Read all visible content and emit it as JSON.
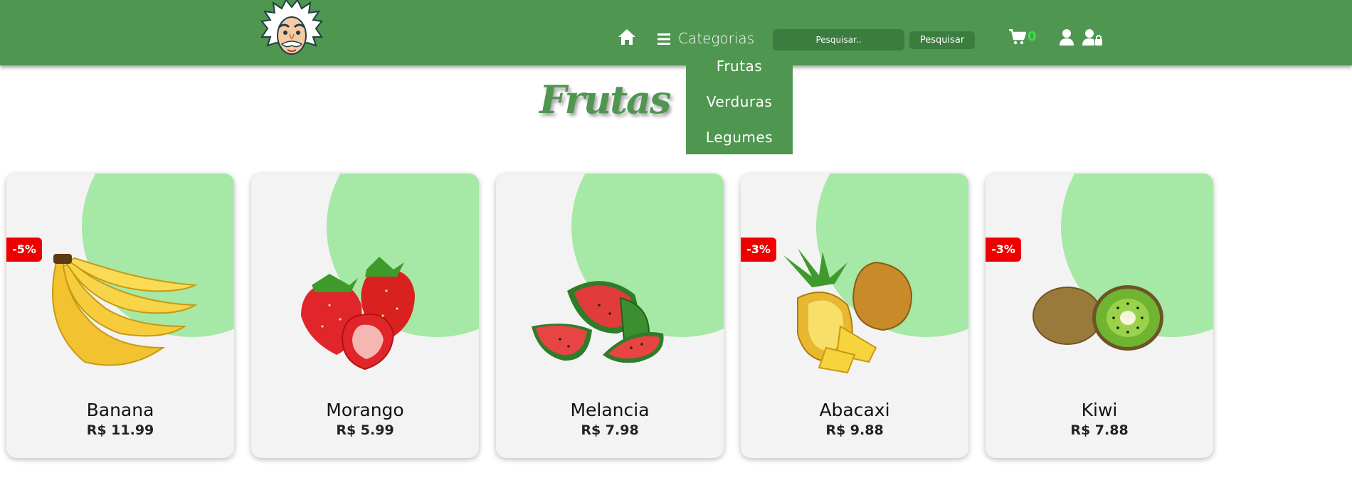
{
  "header": {
    "categories_label": "Categorias",
    "search_placeholder": "Pesquisar..",
    "search_button": "Pesquisar",
    "cart_count": "0",
    "background_color": "#4f9650"
  },
  "dropdown": {
    "items": [
      "Frutas",
      "Verduras",
      "Legumes"
    ]
  },
  "section_title": "Frutas",
  "products": [
    {
      "name": "Banana",
      "price": "R$ 11.99",
      "discount": "-5%"
    },
    {
      "name": "Morango",
      "price": "R$ 5.99",
      "discount": ""
    },
    {
      "name": "Melancia",
      "price": "R$ 7.98",
      "discount": ""
    },
    {
      "name": "Abacaxi",
      "price": "R$ 9.88",
      "discount": "-3%"
    },
    {
      "name": "Kiwi",
      "price": "R$ 7.88",
      "discount": "-3%"
    }
  ],
  "colors": {
    "accent": "#4f9650",
    "card_blob": "#a6e8a6",
    "badge": "#ee0000",
    "cart_count": "#35e34a"
  },
  "icons": [
    "einstein-logo",
    "home-icon",
    "menu-icon",
    "cart-icon",
    "user-icon",
    "user-lock-icon",
    "banana-image",
    "strawberry-image",
    "watermelon-image",
    "pineapple-image",
    "kiwi-image"
  ]
}
